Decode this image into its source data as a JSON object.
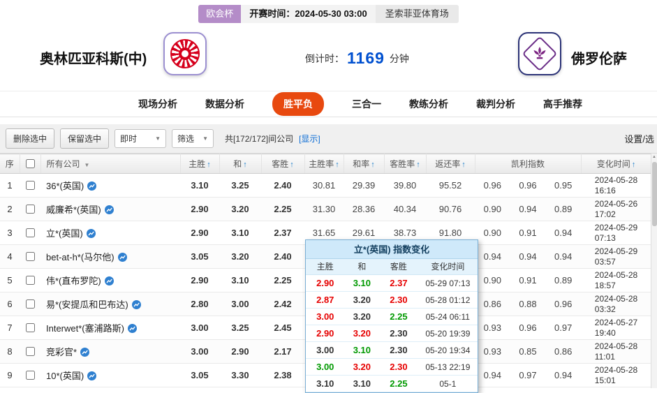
{
  "match": {
    "league": "欧会杯",
    "kickoff_label": "开赛时间：",
    "kickoff_time": "2024-05-30 03:00",
    "venue": "圣索菲亚体育场",
    "home_team": "奥林匹亚科斯(中)",
    "away_team": "佛罗伦萨",
    "countdown_label": "倒计时：",
    "countdown_value": "1169",
    "countdown_unit": "分钟"
  },
  "nav": {
    "tabs": [
      {
        "label": "现场分析",
        "active": false
      },
      {
        "label": "数据分析",
        "active": false
      },
      {
        "label": "胜平负",
        "active": true
      },
      {
        "label": "三合一",
        "active": false
      },
      {
        "label": "教练分析",
        "active": false
      },
      {
        "label": "裁判分析",
        "active": false
      },
      {
        "label": "高手推荐",
        "active": false
      }
    ]
  },
  "toolbar": {
    "delete_selected": "删除选中",
    "keep_selected": "保留选中",
    "mode_dropdown": "即时",
    "filter_dropdown": "筛选",
    "company_count": "共[172/172]间公司",
    "show_link": "[显示]",
    "settings": "设置/选"
  },
  "table": {
    "headers": {
      "index": "序",
      "company": "所有公司",
      "home": "主胜",
      "draw": "和",
      "away": "客胜",
      "home_rate": "主胜率",
      "draw_rate": "和率",
      "away_rate": "客胜率",
      "return_rate": "返还率",
      "kelly": "凯利指数",
      "change_time": "变化时间"
    },
    "rows": [
      {
        "idx": "1",
        "company": "36*(英国)",
        "h": "3.10",
        "hc": "g",
        "d": "3.25",
        "dc": "k",
        "a": "2.40",
        "ac": "r",
        "hr": "30.81",
        "dr": "29.39",
        "ar": "39.80",
        "rr": "95.52",
        "k1": "0.96",
        "k2": "0.96",
        "k3": "0.95",
        "date": "2024-05-28",
        "time": "16:16"
      },
      {
        "idx": "2",
        "company": "威廉希*(英国)",
        "h": "2.90",
        "hc": "g",
        "d": "3.20",
        "dc": "g",
        "a": "2.25",
        "ac": "r",
        "hr": "31.30",
        "dr": "28.36",
        "ar": "40.34",
        "rr": "90.76",
        "k1": "0.90",
        "k2": "0.94",
        "k3": "0.89",
        "date": "2024-05-26",
        "time": "17:02"
      },
      {
        "idx": "3",
        "company": "立*(英国)",
        "h": "2.90",
        "hc": "g",
        "d": "3.10",
        "dc": "g",
        "a": "2.37",
        "ac": "r",
        "hr": "31.65",
        "dr": "29.61",
        "ar": "38.73",
        "rr": "91.80",
        "k1": "0.90",
        "k2": "0.91",
        "k3": "0.94",
        "date": "2024-05-29",
        "time": "07:13"
      },
      {
        "idx": "4",
        "company": "bet-at-h*(马尔他)",
        "h": "3.05",
        "hc": "k",
        "d": "3.20",
        "dc": "g",
        "a": "2.40",
        "ac": "r",
        "hr": "",
        "dr": "",
        "ar": "",
        "rr": "",
        "k1": "0.94",
        "k2": "0.94",
        "k3": "0.94",
        "date": "2024-05-29",
        "time": "03:57"
      },
      {
        "idx": "5",
        "company": "伟*(直布罗陀)",
        "h": "2.90",
        "hc": "g",
        "d": "3.10",
        "dc": "r",
        "a": "2.25",
        "ac": "k",
        "hr": "",
        "dr": "",
        "ar": "",
        "rr": "",
        "k1": "0.90",
        "k2": "0.91",
        "k3": "0.89",
        "date": "2024-05-28",
        "time": "18:57"
      },
      {
        "idx": "6",
        "company": "易*(安提瓜和巴布达)",
        "h": "2.80",
        "hc": "g",
        "d": "3.00",
        "dc": "k",
        "a": "2.42",
        "ac": "r",
        "hr": "",
        "dr": "",
        "ar": "",
        "rr": "",
        "k1": "0.86",
        "k2": "0.88",
        "k3": "0.96",
        "date": "2024-05-28",
        "time": "03:32"
      },
      {
        "idx": "7",
        "company": "Interwet*(塞浦路斯)",
        "h": "3.00",
        "hc": "g",
        "d": "3.25",
        "dc": "g",
        "a": "2.45",
        "ac": "r",
        "hr": "",
        "dr": "",
        "ar": "",
        "rr": "",
        "k1": "0.93",
        "k2": "0.96",
        "k3": "0.97",
        "date": "2024-05-27",
        "time": "19:40"
      },
      {
        "idx": "8",
        "company": "竞彩官*",
        "h": "3.00",
        "hc": "k",
        "d": "2.90",
        "dc": "k",
        "a": "2.17",
        "ac": "k",
        "hr": "",
        "dr": "",
        "ar": "",
        "rr": "",
        "k1": "0.93",
        "k2": "0.85",
        "k3": "0.86",
        "date": "2024-05-28",
        "time": "11:01"
      },
      {
        "idx": "9",
        "company": "10*(英国)",
        "h": "3.05",
        "hc": "g",
        "d": "3.30",
        "dc": "k",
        "a": "2.38",
        "ac": "r",
        "hr": "",
        "dr": "",
        "ar": "",
        "rr": "",
        "k1": "0.94",
        "k2": "0.97",
        "k3": "0.94",
        "date": "2024-05-28",
        "time": "15:01"
      }
    ]
  },
  "popup": {
    "title": "立*(英国) 指数变化",
    "headers": {
      "home": "主胜",
      "draw": "和",
      "away": "客胜",
      "time": "变化时间"
    },
    "rows": [
      {
        "h": "2.90",
        "hc": "r",
        "d": "3.10",
        "dc": "g",
        "a": "2.37",
        "ac": "r",
        "t": "05-29 07:13"
      },
      {
        "h": "2.87",
        "hc": "r",
        "d": "3.20",
        "dc": "k",
        "a": "2.30",
        "ac": "r",
        "t": "05-28 01:12"
      },
      {
        "h": "3.00",
        "hc": "r",
        "d": "3.20",
        "dc": "k",
        "a": "2.25",
        "ac": "g",
        "t": "05-24 06:11"
      },
      {
        "h": "2.90",
        "hc": "r",
        "d": "3.20",
        "dc": "r",
        "a": "2.30",
        "ac": "k",
        "t": "05-20 19:39"
      },
      {
        "h": "3.00",
        "hc": "k",
        "d": "3.10",
        "dc": "g",
        "a": "2.30",
        "ac": "k",
        "t": "05-20 19:34"
      },
      {
        "h": "3.00",
        "hc": "g",
        "d": "3.20",
        "dc": "r",
        "a": "2.30",
        "ac": "r",
        "t": "05-13 22:19"
      },
      {
        "h": "3.10",
        "hc": "k",
        "d": "3.10",
        "dc": "k",
        "a": "2.25",
        "ac": "g",
        "t": "05-1"
      }
    ]
  },
  "colors": {
    "accent_orange": "#e8490f",
    "link_blue": "#0b6cd4",
    "odds_up_red": "#e60000",
    "odds_down_green": "#009900",
    "countdown_blue": "#0050d0",
    "league_badge_purple": "#b48cc8",
    "popup_header_blue": "#cfe9fa"
  }
}
